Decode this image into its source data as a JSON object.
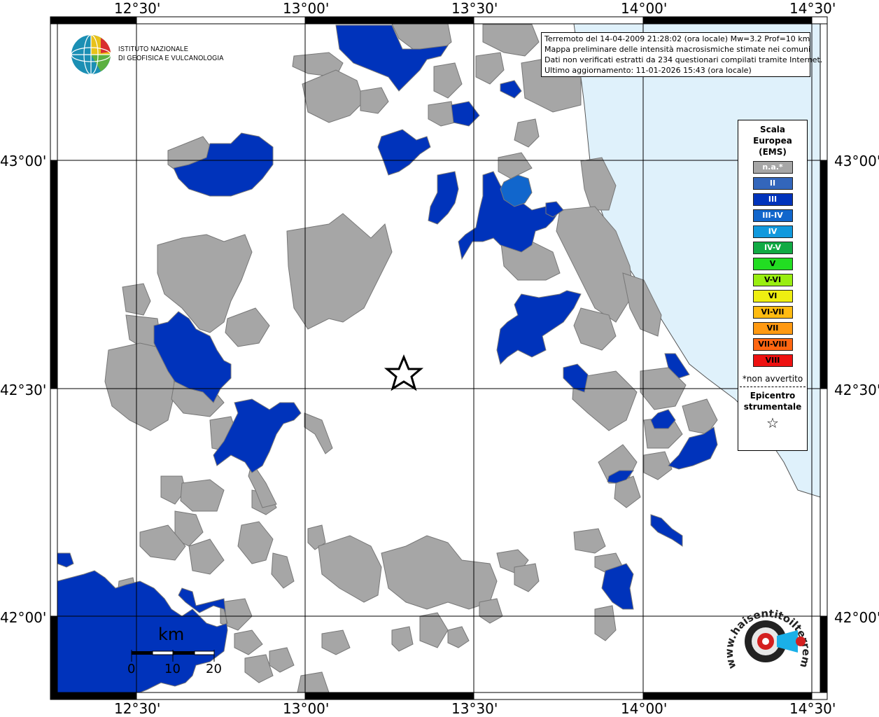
{
  "map": {
    "lon_labels": [
      "12°30'",
      "13°00'",
      "13°30'",
      "14°00'",
      "14°30'"
    ],
    "lat_labels": [
      "43°00'",
      "42°30'",
      "42°00'"
    ],
    "colors": {
      "land_unfelt": "#ffffff",
      "sea": "#dff1fb",
      "municipality_na": "#a6a6a6",
      "intensity_III": "#0033bb",
      "intensity_III_IV": "#1166cc",
      "border": "#777777"
    },
    "epicenter_symbol": "star"
  },
  "info": {
    "line1": "Terremoto del 14-04-2009 21:28:02 (ora locale) Mw=3.2 Prof=10 km",
    "line2": "Mappa preliminare delle intensità macrosismiche stimate nei comuni",
    "line3": "Dati non verificati estratti da 234 questionari compilati tramite Internet.",
    "line4": "Ultimo aggiornamento: 11-01-2026 15:43 (ora locale)"
  },
  "ingv": {
    "line1": "ISTITUTO NAZIONALE",
    "line2": "DI GEOFISICA E VULCANOLOGIA"
  },
  "legend": {
    "title1": "Scala",
    "title2": "Europea",
    "title3": "(EMS)",
    "items": [
      {
        "label": "n.a.*",
        "color": "#a6a6a6",
        "dark": false
      },
      {
        "label": "II",
        "color": "#3366bb",
        "dark": false
      },
      {
        "label": "III",
        "color": "#0033bb",
        "dark": false
      },
      {
        "label": "III-IV",
        "color": "#1166cc",
        "dark": false
      },
      {
        "label": "IV",
        "color": "#1199dd",
        "dark": false
      },
      {
        "label": "IV-V",
        "color": "#11aa44",
        "dark": false
      },
      {
        "label": "V",
        "color": "#22dd22",
        "dark": true
      },
      {
        "label": "V-VI",
        "color": "#99ee11",
        "dark": true
      },
      {
        "label": "VI",
        "color": "#eeee11",
        "dark": true
      },
      {
        "label": "VI-VII",
        "color": "#ffbb11",
        "dark": true
      },
      {
        "label": "VII",
        "color": "#ff9911",
        "dark": true
      },
      {
        "label": "VII-VIII",
        "color": "#ff6611",
        "dark": true
      },
      {
        "label": "VIII",
        "color": "#ee1111",
        "dark": true
      }
    ],
    "note": "*non avvertito",
    "epi1": "Epicentro",
    "epi2": "strumentale",
    "star": "☆"
  },
  "scalebar": {
    "unit": "km",
    "ticks": [
      "0",
      "10",
      "20"
    ]
  },
  "hsit": {
    "text": "www.haisentitoilterremoto.it"
  }
}
